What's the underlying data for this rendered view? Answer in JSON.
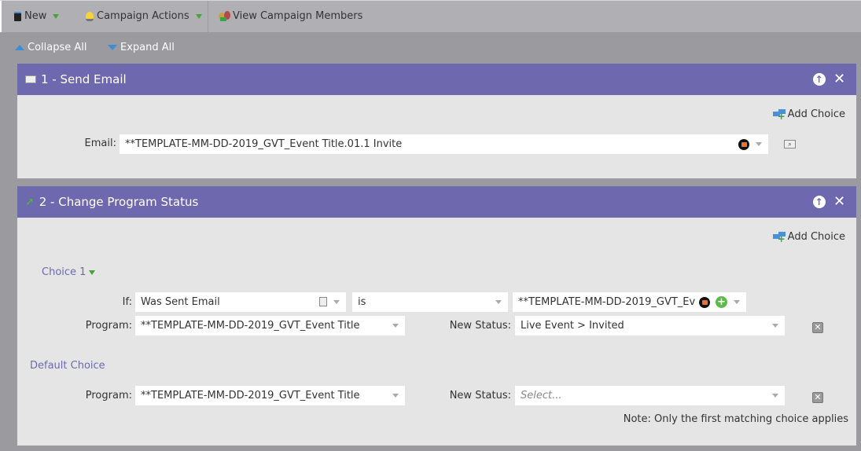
{
  "toolbar": {
    "new_label": "New",
    "campaign_actions_label": "Campaign Actions",
    "view_members_label": "View Campaign Members"
  },
  "subbar": {
    "collapse_all": "Collapse All",
    "expand_all": "Expand All"
  },
  "steps": [
    {
      "title": "1 - Send Email",
      "add_choice": "Add Choice",
      "email_label": "Email:",
      "email_value": "**TEMPLATE-MM-DD-2019_GVT_Event Title.01.1 Invite"
    },
    {
      "title": "2 - Change Program Status",
      "add_choice": "Add Choice",
      "choice1": {
        "label": "Choice 1",
        "if_label": "If:",
        "if_field": "Was Sent Email",
        "operator": "is",
        "if_value": "**TEMPLATE-MM-DD-2019_GVT_Ev",
        "program_label": "Program:",
        "program_value": "**TEMPLATE-MM-DD-2019_GVT_Event Title",
        "status_label": "New Status:",
        "status_value": "Live Event > Invited"
      },
      "default_choice": {
        "label": "Default Choice",
        "program_label": "Program:",
        "program_value": "**TEMPLATE-MM-DD-2019_GVT_Event Title",
        "status_label": "New Status:",
        "status_placeholder": "Select..."
      },
      "note": "Note: Only the first matching choice applies"
    }
  ],
  "colors": {
    "header_purple": "#6e69ae",
    "panel_bg": "#e5e5e5",
    "toolbar_bg": "#b0afb4",
    "page_bg": "#9b9a9f"
  }
}
